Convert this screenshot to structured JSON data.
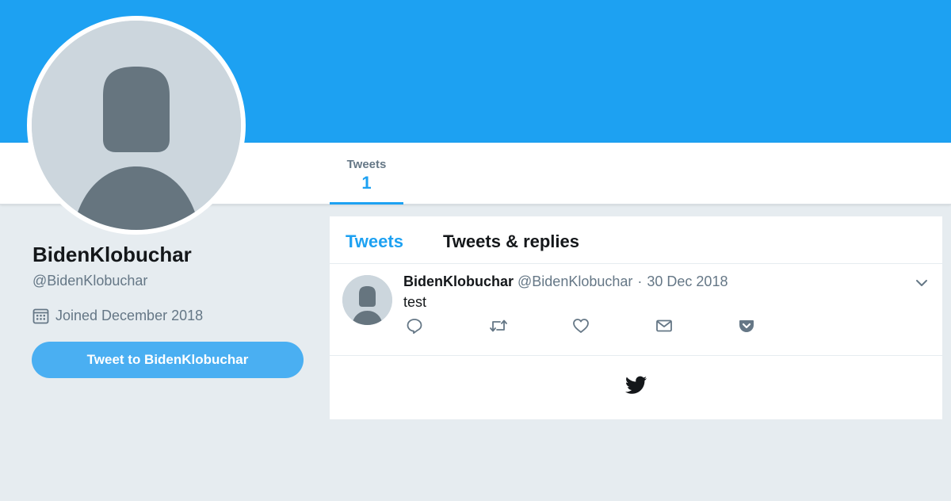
{
  "header": {
    "banner_color": "#1da1f2",
    "nav_tabs": [
      {
        "label": "Tweets",
        "count": "1",
        "active": true
      }
    ]
  },
  "profile": {
    "name": "BidenKlobuchar",
    "handle": "@BidenKlobuchar",
    "joined": "Joined December 2018",
    "joined_icon": "calendar-icon",
    "avatar": "default-avatar",
    "tweet_to_button": "Tweet to BidenKlobuchar"
  },
  "timeline": {
    "tabs": [
      {
        "label": "Tweets",
        "active": true
      },
      {
        "label": "Tweets & replies",
        "active": false
      }
    ],
    "tweets": [
      {
        "name": "BidenKlobuchar",
        "handle": "@BidenKlobuchar",
        "separator": "·",
        "date": "30 Dec 2018",
        "text": "test",
        "actions": [
          "reply-icon",
          "retweet-icon",
          "like-icon",
          "message-icon",
          "pocket-icon"
        ]
      }
    ],
    "footer_icon": "twitter-bird-icon"
  },
  "colors": {
    "accent": "#1da1f2",
    "button": "#4aaff2",
    "muted_text": "#657786",
    "page_bg": "#e6ecf0",
    "avatar_bg": "#ccd6dd",
    "avatar_silhouette": "#66757f"
  }
}
